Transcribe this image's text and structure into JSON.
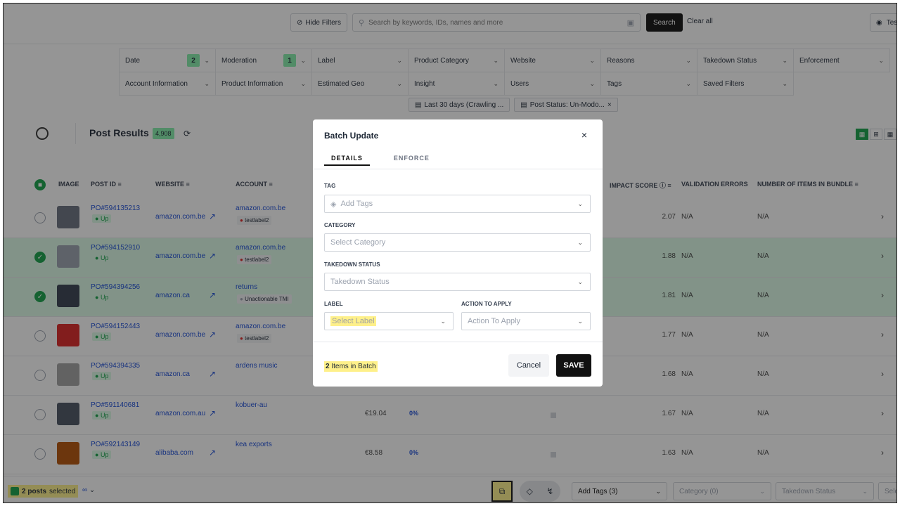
{
  "topbar": {
    "hide_filters": "Hide Filters",
    "search_placeholder": "Search by keywords, IDs, names and more",
    "search_button": "Search",
    "clear_all": "Clear all",
    "team_label": "Tes"
  },
  "filters": [
    {
      "label": "Date",
      "badge": "2"
    },
    {
      "label": "Moderation",
      "badge": "1"
    },
    {
      "label": "Label"
    },
    {
      "label": "Product Category"
    },
    {
      "label": "Website"
    },
    {
      "label": "Reasons"
    },
    {
      "label": "Takedown Status"
    },
    {
      "label": "Enforcement"
    },
    {
      "label": "Account Information"
    },
    {
      "label": "Product Information"
    },
    {
      "label": "Estimated Geo"
    },
    {
      "label": "Insight"
    },
    {
      "label": "Users"
    },
    {
      "label": "Tags"
    },
    {
      "label": "Saved Filters"
    }
  ],
  "chips": [
    "Last 30 days (Crawling ...",
    "Post Status: Un-Modo..."
  ],
  "results": {
    "title": "Post Results",
    "count": "4,908"
  },
  "table": {
    "headers": [
      "IMAGE",
      "POST ID",
      "WEBSITE",
      "ACCOUNT",
      "IMPACT SCORE",
      "VALIDATION ERRORS",
      "NUMBER OF ITEMS IN BUNDLE"
    ],
    "rows": [
      {
        "post_id": "PO#594135213",
        "status": "Up",
        "website": "amazon.com.be",
        "account": "amazon.com.be",
        "account_tag": "testlabel2",
        "price": "",
        "pct": "",
        "impact": "2.07",
        "verr": "N/A",
        "items": "N/A",
        "selected": false
      },
      {
        "post_id": "PO#594152910",
        "status": "Up",
        "website": "amazon.com.be",
        "account": "amazon.com.be",
        "account_tag": "testlabel2",
        "price": "",
        "pct": "",
        "impact": "1.88",
        "verr": "N/A",
        "items": "N/A",
        "selected": true
      },
      {
        "post_id": "PO#594394256",
        "status": "Up",
        "website": "amazon.ca",
        "account": "returns",
        "account_tag": "Unactionable TMI",
        "price": "",
        "pct": "",
        "impact": "1.81",
        "verr": "N/A",
        "items": "N/A",
        "selected": true
      },
      {
        "post_id": "PO#594152443",
        "status": "Up",
        "website": "amazon.com.be",
        "account": "amazon.com.be",
        "account_tag": "testlabel2",
        "price": "",
        "pct": "",
        "impact": "1.77",
        "verr": "N/A",
        "items": "N/A",
        "selected": false
      },
      {
        "post_id": "PO#594394335",
        "status": "Up",
        "website": "amazon.ca",
        "account": "ardens music",
        "account_tag": "",
        "price": "",
        "pct": "",
        "impact": "1.68",
        "verr": "N/A",
        "items": "N/A",
        "selected": false
      },
      {
        "post_id": "PO#591140681",
        "status": "Up",
        "website": "amazon.com.au",
        "account": "kobuer-au",
        "account_tag": "",
        "price": "€19.04",
        "pct": "0%",
        "impact": "1.67",
        "verr": "N/A",
        "items": "N/A",
        "selected": false
      },
      {
        "post_id": "PO#592143149",
        "status": "Up",
        "website": "alibaba.com",
        "account": "kea exports",
        "account_tag": "",
        "price": "€8.58",
        "pct": "0%",
        "impact": "1.63",
        "verr": "N/A",
        "items": "N/A",
        "selected": false
      }
    ]
  },
  "bottombar": {
    "selected_count": "2 posts",
    "selected_word": "selected",
    "add_tags": "Add Tags (3)",
    "category": "Category (0)",
    "takedown": "Takedown Status",
    "select": "Sele"
  },
  "modal": {
    "title": "Batch Update",
    "tabs": [
      "DETAILS",
      "ENFORCE"
    ],
    "tag_label": "TAG",
    "tag_placeholder": "Add Tags",
    "category_label": "CATEGORY",
    "category_placeholder": "Select Category",
    "takedown_label": "TAKEDOWN STATUS",
    "takedown_placeholder": "Takedown Status",
    "label_label": "LABEL",
    "label_placeholder": "Select Label",
    "action_label": "ACTION TO APPLY",
    "action_placeholder": "Action To Apply",
    "batch_num": "2",
    "batch_text": "Items in Batch",
    "cancel": "Cancel",
    "save": "SAVE"
  },
  "colors": {
    "accent": "#16a34a",
    "badge_green": "#86efac",
    "highlight": "#fef08a",
    "link": "#1d4ed8"
  }
}
